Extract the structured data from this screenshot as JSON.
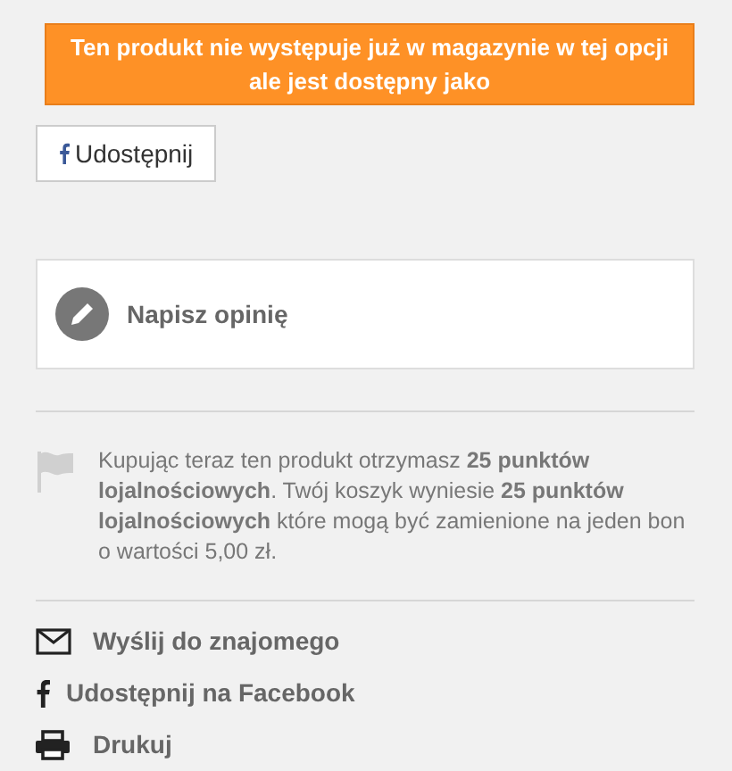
{
  "banner": {
    "text": "Ten produkt nie występuje już w magazynie w tej opcji ale jest dostępny jako"
  },
  "share_button": {
    "label": "Udostępnij"
  },
  "review": {
    "label": "Napisz opinię"
  },
  "loyalty": {
    "text": "Kupując teraz ten produkt otrzymasz **25 punktów lojalnościowych**. Twój koszyk wyniesie **25 punktów lojalnościowych** które mogą być zamienione na jeden bon o wartości 5,00 zł."
  },
  "actions": [
    {
      "kind": "email",
      "label": "Wyślij do znajomego"
    },
    {
      "kind": "facebook",
      "label": "Udostępnij na Facebook"
    },
    {
      "kind": "print",
      "label": "Drukuj"
    }
  ]
}
